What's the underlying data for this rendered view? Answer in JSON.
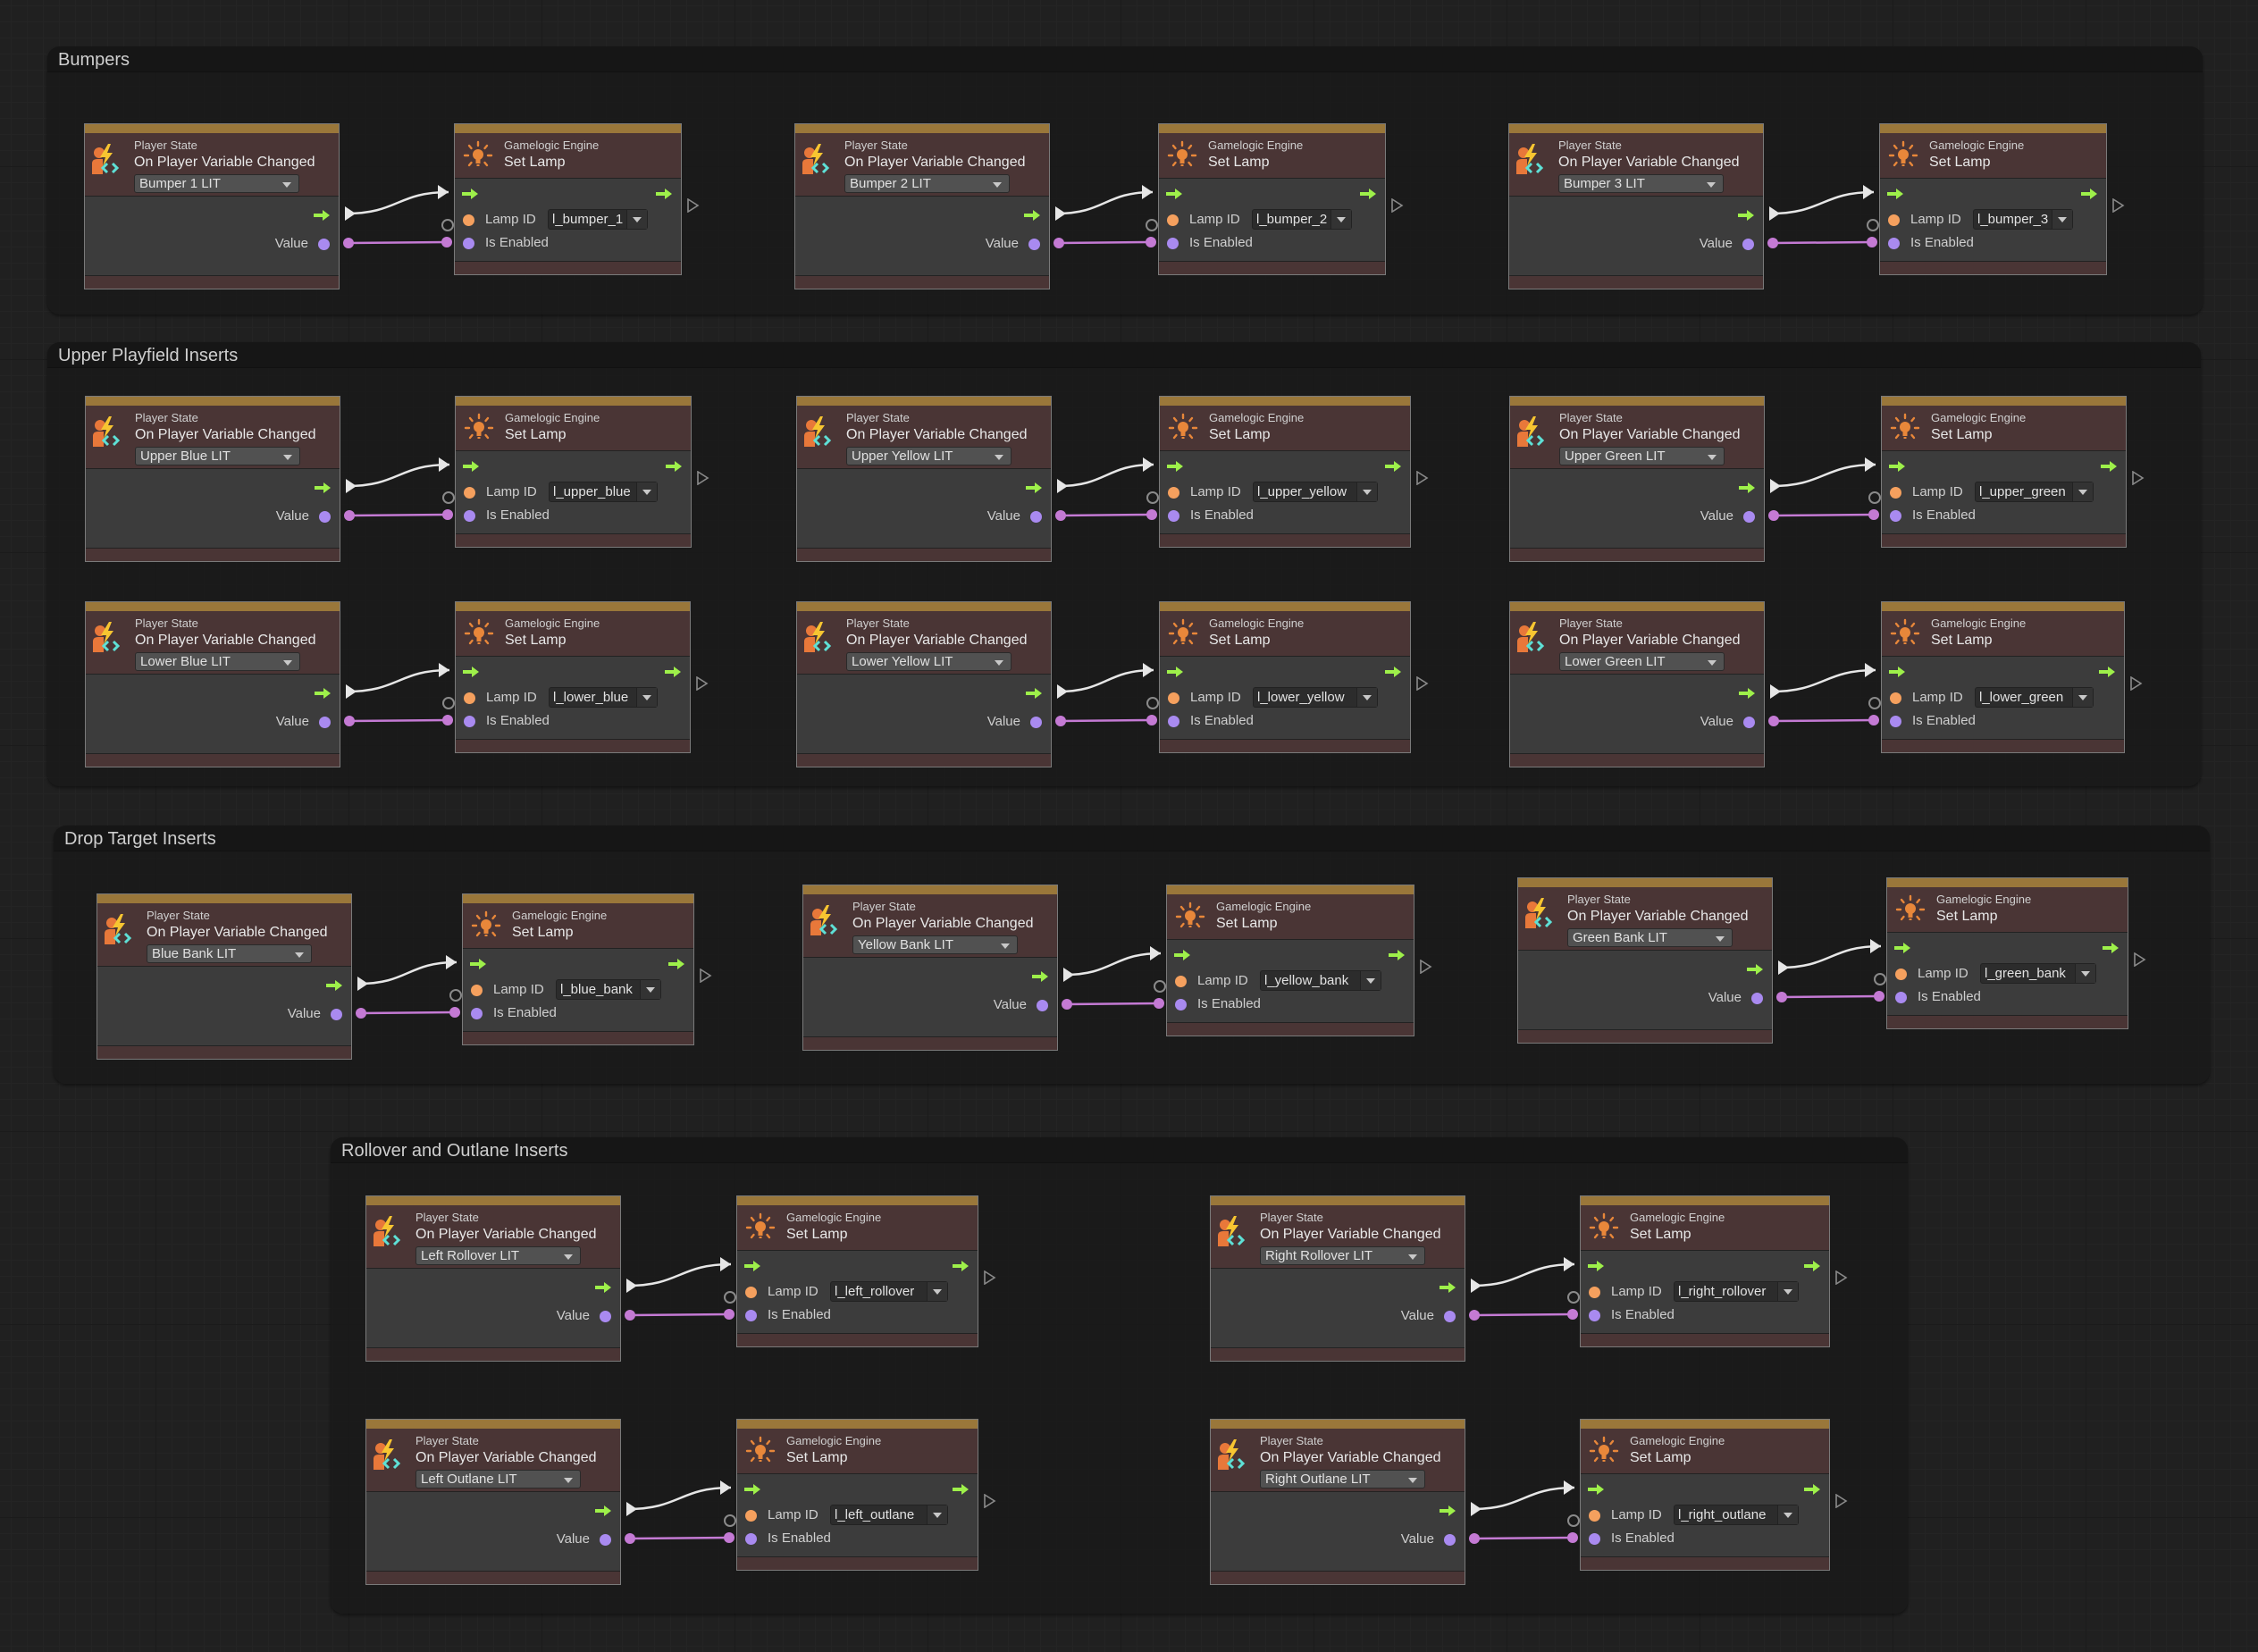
{
  "colors": {
    "flow_arrow": "#9ef04a",
    "value_port": "#a98af0",
    "lamp_port": "#f5a05e",
    "data_wire": "#c47ad4",
    "flow_wire": "#e6e6e6",
    "node_header": "#4a3535",
    "node_accent_bar": "#9a773a"
  },
  "node_templates": {
    "player_state": {
      "category": "Player State",
      "title": "On Player Variable Changed",
      "value_label": "Value",
      "icon": "player-state-icon"
    },
    "set_lamp": {
      "category": "Gamelogic Engine",
      "title": "Set Lamp",
      "lamp_id_label": "Lamp ID",
      "is_enabled_label": "Is Enabled",
      "icon": "lamp-icon"
    }
  },
  "groups": [
    {
      "title": "Bumpers",
      "pairs": [
        {
          "variable": "Bumper 1 LIT",
          "lamp_id": "l_bumper_1"
        },
        {
          "variable": "Bumper 2 LIT",
          "lamp_id": "l_bumper_2"
        },
        {
          "variable": "Bumper 3 LIT",
          "lamp_id": "l_bumper_3"
        }
      ]
    },
    {
      "title": "Upper Playfield Inserts",
      "pairs": [
        {
          "variable": "Upper Blue LIT",
          "lamp_id": "l_upper_blue"
        },
        {
          "variable": "Upper Yellow LIT",
          "lamp_id": "l_upper_yellow"
        },
        {
          "variable": "Upper Green LIT",
          "lamp_id": "l_upper_green"
        },
        {
          "variable": "Lower Blue LIT",
          "lamp_id": "l_lower_blue"
        },
        {
          "variable": "Lower Yellow LIT",
          "lamp_id": "l_lower_yellow"
        },
        {
          "variable": "Lower Green LIT",
          "lamp_id": "l_lower_green"
        }
      ]
    },
    {
      "title": "Drop Target Inserts",
      "pairs": [
        {
          "variable": "Blue Bank LIT",
          "lamp_id": "l_blue_bank"
        },
        {
          "variable": "Yellow Bank LIT",
          "lamp_id": "l_yellow_bank"
        },
        {
          "variable": "Green Bank LIT",
          "lamp_id": "l_green_bank"
        }
      ]
    },
    {
      "title": "Rollover and Outlane Inserts",
      "pairs": [
        {
          "variable": "Left Rollover LIT",
          "lamp_id": "l_left_rollover"
        },
        {
          "variable": "Right Rollover LIT",
          "lamp_id": "l_right_rollover"
        },
        {
          "variable": "Left Outlane LIT",
          "lamp_id": "l_left_outlane"
        },
        {
          "variable": "Right Outlane LIT",
          "lamp_id": "l_right_outlane"
        }
      ]
    }
  ]
}
